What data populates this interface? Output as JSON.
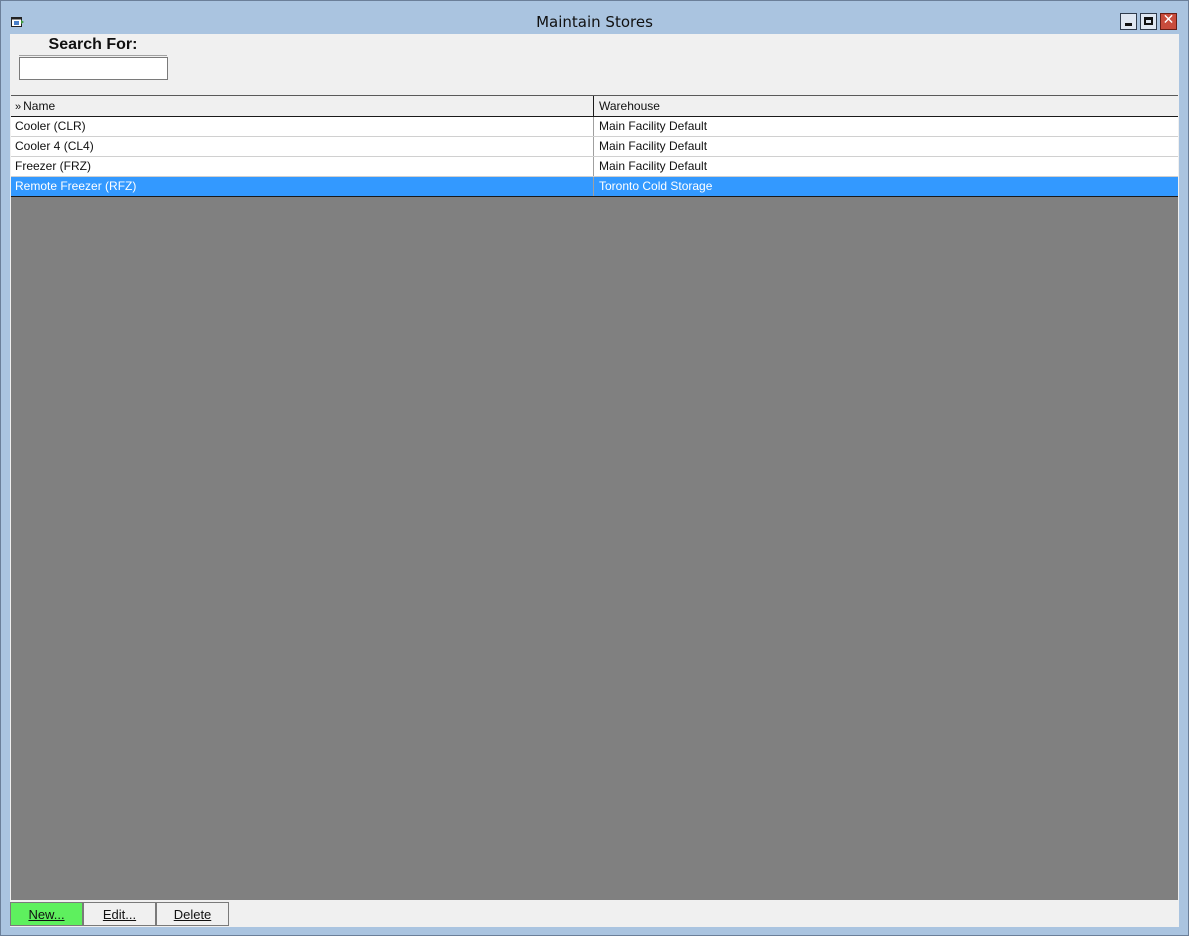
{
  "window": {
    "title": "Maintain Stores",
    "icons": [
      "app-window-icon",
      "minimize-icon",
      "maximize-icon",
      "close-icon"
    ]
  },
  "search": {
    "label": "Search For:",
    "value": "",
    "placeholder": ""
  },
  "table": {
    "sort_indicator": "»",
    "columns": [
      "Name",
      "Warehouse"
    ],
    "rows": [
      {
        "name": "Cooler (CLR)",
        "warehouse": "Main Facility Default",
        "selected": false
      },
      {
        "name": "Cooler 4 (CL4)",
        "warehouse": "Main Facility Default",
        "selected": false
      },
      {
        "name": "Freezer (FRZ)",
        "warehouse": "Main Facility Default",
        "selected": false
      },
      {
        "name": "Remote Freezer (RFZ)",
        "warehouse": "Toronto Cold Storage",
        "selected": true
      }
    ]
  },
  "buttons": {
    "new_label": "New...",
    "edit_label": "Edit...",
    "delete_label": "Delete"
  },
  "colors": {
    "selection": "#3399ff",
    "new_button": "#5ef05e",
    "close_button": "#c94c3c"
  }
}
